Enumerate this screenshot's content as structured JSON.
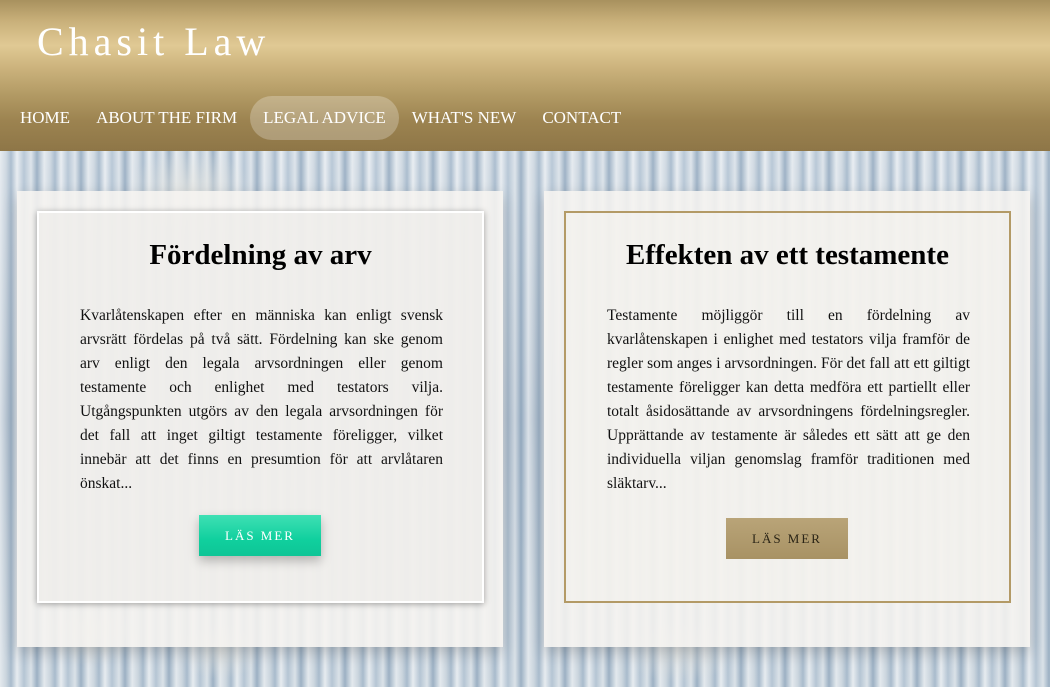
{
  "site": {
    "brand": "Chasit Law"
  },
  "nav": {
    "items": [
      {
        "label": "HOME"
      },
      {
        "label": "ABOUT THE FIRM"
      },
      {
        "label": "LEGAL ADVICE"
      },
      {
        "label": "WHAT'S NEW"
      },
      {
        "label": "CONTACT"
      }
    ],
    "active": "LEGAL ADVICE"
  },
  "cards": [
    {
      "title": "Fördelning av arv",
      "text": "Kvarlåtenskapen efter en människa kan enligt svensk arvsrätt fördelas på två sätt. Fördelning kan ske genom arv enligt den legala arvsordningen eller genom testamente och enlighet med testators vilja. Utgångspunkten utgörs av den legala arvsordningen för det fall att inget giltigt testamente föreligger, vilket innebär att det finns en presumtion för att arvlåtaren önskat...",
      "button": "LÄS MER"
    },
    {
      "title": "Effekten av ett testamente",
      "text": "Testamente möjliggör till en fördelning av kvarlåtenskapen i enlighet med testators vilja framför de regler som anges i arvsordningen. För det fall att ett giltigt testamente föreligger kan detta medföra ett partiellt eller totalt åsidosättande av arvsordningens fördelningsregler. Upprättande av testamente är således ett sätt att ge den individuella viljan genomslag framför traditionen med släktarv...",
      "button": "LÄS MER"
    }
  ],
  "colors": {
    "header_gold": "#c9b07a",
    "accent_green": "#10d09e",
    "accent_gold": "#a89264"
  }
}
